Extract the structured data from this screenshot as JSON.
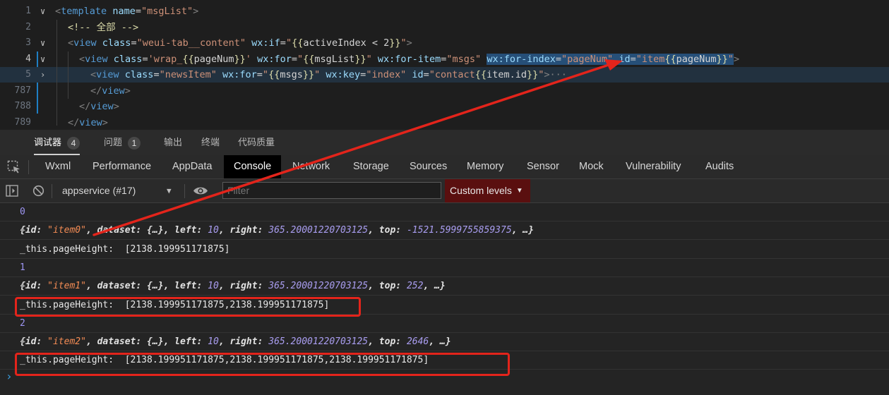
{
  "editor": {
    "lines": [
      {
        "num": "1",
        "segments": [
          {
            "t": "<",
            "c": "e"
          },
          {
            "t": "template",
            "c": "t"
          },
          {
            "t": " ",
            "c": "w"
          },
          {
            "t": "name",
            "c": "a"
          },
          {
            "t": "=",
            "c": "w"
          },
          {
            "t": "\"msgList\"",
            "c": "s"
          },
          {
            "t": ">",
            "c": "e"
          }
        ]
      },
      {
        "num": "2",
        "segments": [
          {
            "t": "<!-- 全部 -->",
            "c": "y"
          }
        ]
      },
      {
        "num": "3",
        "segments": [
          {
            "t": "<",
            "c": "e"
          },
          {
            "t": "view",
            "c": "t"
          },
          {
            "t": " ",
            "c": "w"
          },
          {
            "t": "class",
            "c": "a"
          },
          {
            "t": "=",
            "c": "w"
          },
          {
            "t": "\"weui-tab__content\"",
            "c": "s"
          },
          {
            "t": " ",
            "c": "w"
          },
          {
            "t": "wx:if",
            "c": "a"
          },
          {
            "t": "=",
            "c": "w"
          },
          {
            "t": "\"",
            "c": "s"
          },
          {
            "t": "{{",
            "c": "y"
          },
          {
            "t": "activeIndex < 2",
            "c": "w"
          },
          {
            "t": "}}",
            "c": "y"
          },
          {
            "t": "\"",
            "c": "s"
          },
          {
            "t": ">",
            "c": "e"
          }
        ]
      },
      {
        "num": "4",
        "segments": [
          {
            "t": "<",
            "c": "e"
          },
          {
            "t": "view",
            "c": "t"
          },
          {
            "t": " ",
            "c": "w"
          },
          {
            "t": "class",
            "c": "a"
          },
          {
            "t": "=",
            "c": "w"
          },
          {
            "t": "'wrap_",
            "c": "s"
          },
          {
            "t": "{{",
            "c": "y"
          },
          {
            "t": "pageNum",
            "c": "w"
          },
          {
            "t": "}}",
            "c": "y"
          },
          {
            "t": "'",
            "c": "s"
          },
          {
            "t": " ",
            "c": "w"
          },
          {
            "t": "wx:for",
            "c": "a"
          },
          {
            "t": "=",
            "c": "w"
          },
          {
            "t": "\"",
            "c": "s"
          },
          {
            "t": "{{",
            "c": "y"
          },
          {
            "t": "msgList",
            "c": "w"
          },
          {
            "t": "}}",
            "c": "y"
          },
          {
            "t": "\"",
            "c": "s"
          },
          {
            "t": " ",
            "c": "w"
          },
          {
            "t": "wx:for-item",
            "c": "a"
          },
          {
            "t": "=",
            "c": "w"
          },
          {
            "t": "\"msgs\"",
            "c": "s"
          },
          {
            "t": " ",
            "c": "w"
          },
          {
            "t": "wx:for-index",
            "c": "a",
            "sel": true
          },
          {
            "t": "=",
            "c": "w",
            "sel": true
          },
          {
            "t": "\"pageNum\"",
            "c": "s",
            "sel": true
          },
          {
            "t": " ",
            "c": "w",
            "sel": true
          },
          {
            "t": "id",
            "c": "a",
            "sel": true
          },
          {
            "t": "=",
            "c": "w",
            "sel": true
          },
          {
            "t": "\"item",
            "c": "s",
            "sel": true
          },
          {
            "t": "{{",
            "c": "y",
            "sel": true
          },
          {
            "t": "pageNum",
            "c": "w",
            "sel": true
          },
          {
            "t": "}}",
            "c": "y",
            "sel": true
          },
          {
            "t": "\"",
            "c": "s",
            "sel": true
          },
          {
            "t": ">",
            "c": "e"
          }
        ]
      },
      {
        "num": "5",
        "segments": [
          {
            "t": "<",
            "c": "e"
          },
          {
            "t": "view",
            "c": "t"
          },
          {
            "t": " ",
            "c": "w"
          },
          {
            "t": "class",
            "c": "a"
          },
          {
            "t": "=",
            "c": "w"
          },
          {
            "t": "\"newsItem\"",
            "c": "s"
          },
          {
            "t": " ",
            "c": "w"
          },
          {
            "t": "wx:for",
            "c": "a"
          },
          {
            "t": "=",
            "c": "w"
          },
          {
            "t": "\"",
            "c": "s"
          },
          {
            "t": "{{",
            "c": "y"
          },
          {
            "t": "msgs",
            "c": "w"
          },
          {
            "t": "}}",
            "c": "y"
          },
          {
            "t": "\"",
            "c": "s"
          },
          {
            "t": " ",
            "c": "w"
          },
          {
            "t": "wx:key",
            "c": "a"
          },
          {
            "t": "=",
            "c": "w"
          },
          {
            "t": "\"index\"",
            "c": "s"
          },
          {
            "t": " ",
            "c": "w"
          },
          {
            "t": "id",
            "c": "a"
          },
          {
            "t": "=",
            "c": "w"
          },
          {
            "t": "\"contact",
            "c": "s"
          },
          {
            "t": "{{",
            "c": "y"
          },
          {
            "t": "item.id",
            "c": "w"
          },
          {
            "t": "}}",
            "c": "y"
          },
          {
            "t": "\"",
            "c": "s"
          },
          {
            "t": ">",
            "c": "e"
          },
          {
            "t": "···",
            "c": "e"
          }
        ]
      },
      {
        "num": "787",
        "segments": [
          {
            "t": "</",
            "c": "e"
          },
          {
            "t": "view",
            "c": "t"
          },
          {
            "t": ">",
            "c": "e"
          }
        ]
      },
      {
        "num": "788",
        "segments": [
          {
            "t": "</",
            "c": "e"
          },
          {
            "t": "view",
            "c": "t"
          },
          {
            "t": ">",
            "c": "e"
          }
        ]
      },
      {
        "num": "789",
        "segments": [
          {
            "t": "</",
            "c": "e"
          },
          {
            "t": "view",
            "c": "t"
          },
          {
            "t": ">",
            "c": "e"
          }
        ]
      }
    ]
  },
  "panel_tabs": [
    {
      "label": "调试器",
      "badge": "4",
      "active": true
    },
    {
      "label": "问题",
      "badge": "1",
      "active": false
    },
    {
      "label": "输出",
      "badge": "",
      "active": false
    },
    {
      "label": "终端",
      "badge": "",
      "active": false
    },
    {
      "label": "代码质量",
      "badge": "",
      "active": false
    }
  ],
  "devtools_tabs": [
    "Wxml",
    "Performance",
    "AppData",
    "Console",
    "Network",
    "Storage",
    "Sources",
    "Memory",
    "Sensor",
    "Mock",
    "Vulnerability",
    "Audits"
  ],
  "devtools_active_tab": "Console",
  "toolbar": {
    "context": "appservice (#17)",
    "filter_placeholder": "Filter",
    "levels_label": "Custom levels"
  },
  "console": {
    "rows": [
      {
        "type": "num",
        "text": "0"
      },
      {
        "type": "obj",
        "id": "\"item0\"",
        "dataset": "{…}",
        "left": "10",
        "right": "365.20001220703125",
        "top": "-1521.5999755859375"
      },
      {
        "type": "plain",
        "text": "_this.pageHeight:  [2138.199951171875]"
      },
      {
        "type": "num",
        "text": "1"
      },
      {
        "type": "obj",
        "id": "\"item1\"",
        "dataset": "{…}",
        "left": "10",
        "right": "365.20001220703125",
        "top": "252"
      },
      {
        "type": "plain",
        "text": "_this.pageHeight:  [2138.199951171875,2138.199951171875]"
      },
      {
        "type": "num",
        "text": "2"
      },
      {
        "type": "obj",
        "id": "\"item2\"",
        "dataset": "{…}",
        "left": "10",
        "right": "365.20001220703125",
        "top": "2646"
      },
      {
        "type": "plain",
        "text": "_this.pageHeight:  [2138.199951171875,2138.199951171875,2138.199951171875]"
      }
    ],
    "prompt_symbol": "›"
  },
  "colors": {
    "annotation_red": "#e3241b",
    "console_number": "#9d95f2",
    "console_string": "#f28b54",
    "levels_bg": "#5a0f0f"
  }
}
